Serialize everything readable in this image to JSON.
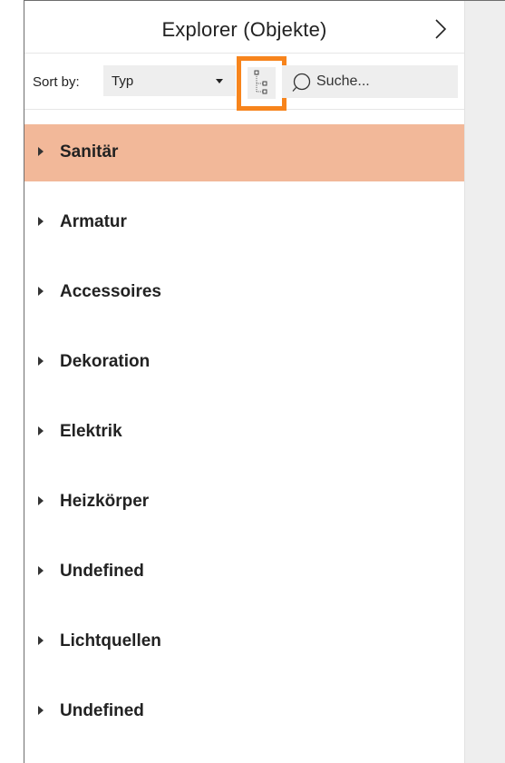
{
  "header": {
    "title": "Explorer (Objekte)",
    "collapse_icon": "chevron-right-icon"
  },
  "toolbar": {
    "sort_label": "Sort by:",
    "sort_value": "Typ",
    "tree_toggle_icon": "tree-view-icon",
    "highlight_color": "#f7841c",
    "search_placeholder": "Suche...",
    "search_value": ""
  },
  "list": {
    "items": [
      {
        "label": "Sanitär",
        "selected": true
      },
      {
        "label": "Armatur",
        "selected": false
      },
      {
        "label": "Accessoires",
        "selected": false
      },
      {
        "label": "Dekoration",
        "selected": false
      },
      {
        "label": "Elektrik",
        "selected": false
      },
      {
        "label": "Heizkörper",
        "selected": false
      },
      {
        "label": "Undefined",
        "selected": false
      },
      {
        "label": "Lichtquellen",
        "selected": false
      },
      {
        "label": "Undefined",
        "selected": false
      }
    ]
  },
  "colors": {
    "selected_row": "#f2b899",
    "side_pane": "#eeeeee"
  }
}
